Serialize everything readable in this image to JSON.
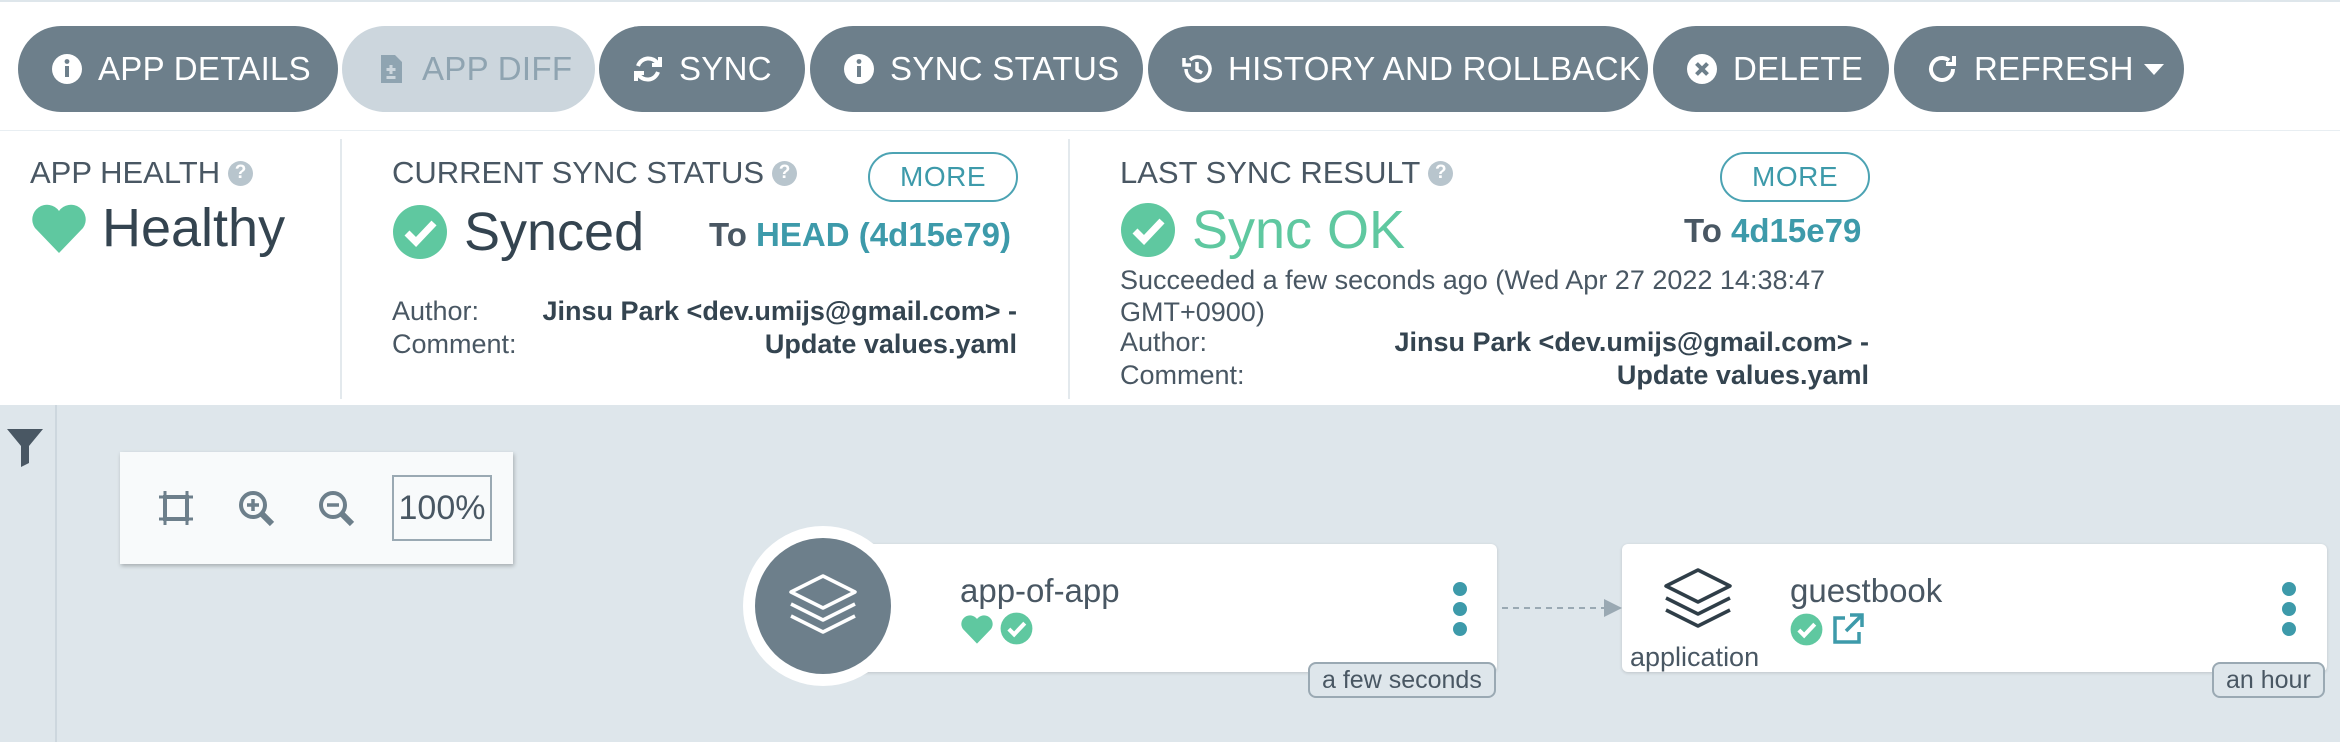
{
  "toolbar": {
    "buttons": [
      {
        "label": "APP DETAILS",
        "icon": "info-circle-icon"
      },
      {
        "label": "APP DIFF",
        "icon": "file-diff-icon"
      },
      {
        "label": "SYNC",
        "icon": "sync-arrows-icon"
      },
      {
        "label": "SYNC STATUS",
        "icon": "info-circle-icon"
      },
      {
        "label": "HISTORY AND ROLLBACK",
        "icon": "history-icon"
      },
      {
        "label": "DELETE",
        "icon": "times-circle-icon"
      },
      {
        "label": "REFRESH",
        "icon": "redo-icon",
        "caret": "caret-down-icon"
      }
    ]
  },
  "app_health": {
    "title": "APP HEALTH",
    "value": "Healthy",
    "icon": "heart-icon"
  },
  "current_sync": {
    "title": "CURRENT SYNC STATUS",
    "more": "MORE",
    "value": "Synced",
    "to_prefix": "To",
    "to_rev": "HEAD (4d15e79)",
    "author_label": "Author:",
    "author_value": "Jinsu Park <dev.umijs@gmail.com> -",
    "comment_label": "Comment:",
    "comment_value": "Update values.yaml"
  },
  "last_sync": {
    "title": "LAST SYNC RESULT",
    "more": "MORE",
    "value": "Sync OK",
    "to_prefix": "To",
    "to_rev": "4d15e79",
    "succeeded_line1": "Succeeded a few seconds ago (Wed Apr 27 2022 14:38:47",
    "succeeded_line2": "GMT+0900)",
    "author_label": "Author:",
    "author_value": "Jinsu Park <dev.umijs@gmail.com> -",
    "comment_label": "Comment:",
    "comment_value": "Update values.yaml"
  },
  "zoom": {
    "level": "100%"
  },
  "graph": {
    "root": {
      "name": "app-of-app",
      "age": "a few seconds"
    },
    "child": {
      "name": "guestbook",
      "kind": "application",
      "age": "an hour"
    }
  },
  "colors": {
    "button": "#6d7f8b",
    "button_disabled": "#ccd6dd",
    "healthy": "#5fc8a0",
    "link": "#3d9aaa",
    "canvas": "#dee6eb"
  }
}
